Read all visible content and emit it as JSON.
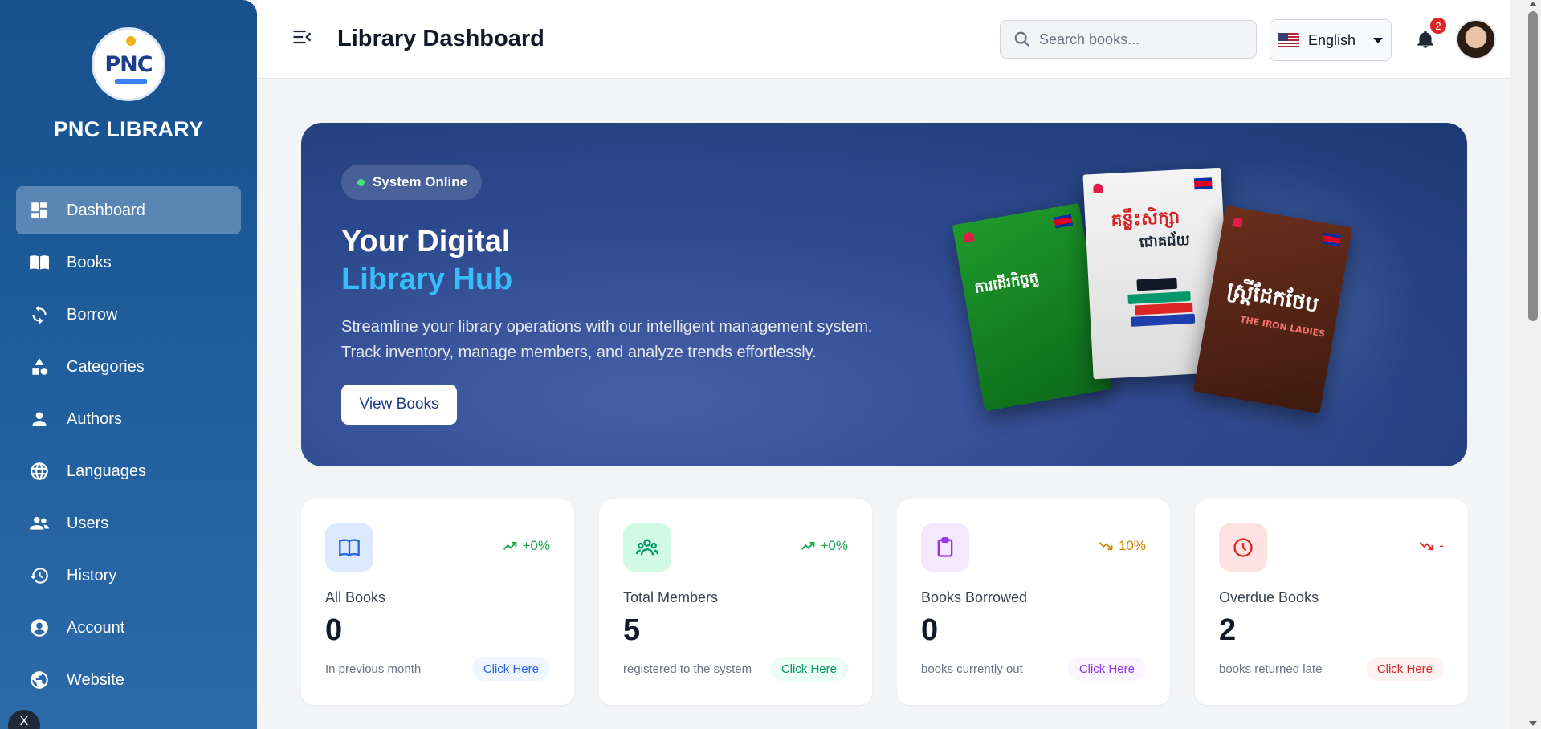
{
  "brand": {
    "name": "PNC LIBRARY",
    "logo_text": "PNC"
  },
  "sidebar": {
    "items": [
      {
        "label": "Dashboard",
        "icon": "dashboard-icon"
      },
      {
        "label": "Books",
        "icon": "book-open-icon"
      },
      {
        "label": "Borrow",
        "icon": "refresh-icon"
      },
      {
        "label": "Categories",
        "icon": "shapes-icon"
      },
      {
        "label": "Authors",
        "icon": "person-icon"
      },
      {
        "label": "Languages",
        "icon": "globe-icon"
      },
      {
        "label": "Users",
        "icon": "users-icon"
      },
      {
        "label": "History",
        "icon": "history-icon"
      },
      {
        "label": "Account",
        "icon": "account-circle-icon"
      },
      {
        "label": "Website",
        "icon": "website-globe-icon"
      }
    ],
    "active": "Dashboard"
  },
  "header": {
    "title": "Library Dashboard",
    "search_placeholder": "Search books...",
    "language": "English",
    "notification_count": "2"
  },
  "hero": {
    "status": "System Online",
    "title_line1": "Your Digital",
    "title_line2": "Library Hub",
    "description": "Streamline your library operations with our intelligent management system. Track inventory, manage members, and analyze trends effortlessly.",
    "button": "View Books",
    "books": [
      {
        "title": "ការដើរកិច្ចតួ",
        "color": "#1f9a2b"
      },
      {
        "title": "គន្លឹះសិក្សា",
        "subtitle": "ជោគជ័យ",
        "color": "#f4f4f4"
      },
      {
        "title": "ស្ត្រីដែកថែប",
        "subtitle": "THE IRON LADIES",
        "color": "#6b2f1c"
      }
    ]
  },
  "stats": [
    {
      "label": "All Books",
      "value": "0",
      "trend": "+0%",
      "subtext": "In previous month",
      "button": "Click Here",
      "accent": "#2563eb",
      "icon_bg": "#dbeafe",
      "trend_color": "#16a34a",
      "btn_bg": "#eff6ff",
      "icon": "book-open-icon"
    },
    {
      "label": "Total Members",
      "value": "5",
      "trend": "+0%",
      "subtext": "registered to the system",
      "button": "Click Here",
      "accent": "#059669",
      "icon_bg": "#d1fae5",
      "trend_color": "#16a34a",
      "btn_bg": "#ecfdf5",
      "icon": "users-icon"
    },
    {
      "label": "Books Borrowed",
      "value": "0",
      "trend": "10%",
      "subtext": "books currently out",
      "button": "Click Here",
      "accent": "#9333ea",
      "icon_bg": "#f3e8ff",
      "trend_color": "#ca8a04",
      "btn_bg": "#faf5ff",
      "icon": "clipboard-icon"
    },
    {
      "label": "Overdue Books",
      "value": "2",
      "trend": "-",
      "subtext": "books returned late",
      "button": "Click Here",
      "accent": "#dc2626",
      "icon_bg": "#fee2e2",
      "trend_color": "#dc2626",
      "btn_bg": "#fef2f2",
      "icon": "clock-icon"
    }
  ]
}
